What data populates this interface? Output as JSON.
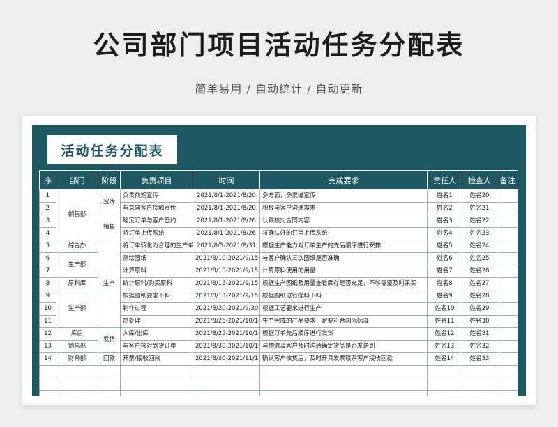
{
  "page": {
    "main_title": "公司部门项目活动任务分配表",
    "subtitle": "简单易用 / 自动统计 / 自动更新"
  },
  "sheet": {
    "title": "活动任务分配表",
    "headers": [
      "序",
      "部门",
      "阶段",
      "负责项目",
      "时间",
      "完成要求",
      "责任人",
      "检查人",
      "备注"
    ],
    "rows": [
      {
        "no": "1",
        "item": "负责前期宣传",
        "time": "2021/8/1-2021/8/20",
        "req": "多方面，多渠道宣传",
        "owner": "姓名1",
        "checker": "姓名20",
        "note": ""
      },
      {
        "no": "2",
        "item": "与意向客户接触宣传",
        "time": "2021/8/1-2021/8/20",
        "req": "积极与客户沟通需求",
        "owner": "姓名2",
        "checker": "姓名21",
        "note": ""
      },
      {
        "no": "3",
        "item": "确定订单与客户签约",
        "time": "2021/8/1-2021/8/26",
        "req": "认真核对合同内容",
        "owner": "姓名3",
        "checker": "姓名22",
        "note": ""
      },
      {
        "no": "4",
        "item": "将订单上传系统",
        "time": "2021/8/1-2021/8/26",
        "req": "将确认好的订单上传系统",
        "owner": "姓名4",
        "checker": "姓名23",
        "note": ""
      },
      {
        "no": "5",
        "item": "将订单转化为合理的生产单",
        "time": "2021/8/5-2021/8/31",
        "req": "根据生产能力对订单生产的先后顺序进行安排",
        "owner": "姓名5",
        "checker": "姓名24",
        "note": ""
      },
      {
        "no": "6",
        "item": "测绘图纸",
        "time": "2021/8/10-2021/9/15",
        "req": "与客户确认三次图纸是否准确",
        "owner": "姓名6",
        "checker": "姓名25",
        "note": ""
      },
      {
        "no": "7",
        "item": "计算原料",
        "time": "2021/8/10-2021/9/15",
        "req": "计算原料使用的用量",
        "owner": "姓名7",
        "checker": "姓名26",
        "note": ""
      },
      {
        "no": "8",
        "item": "统计原料/购买原料",
        "time": "2021/8/13-2021/9/15",
        "req": "根据生产图纸及用量查看库存是否充足，不够需要及时采买",
        "owner": "姓名8",
        "checker": "姓名27",
        "note": ""
      },
      {
        "no": "9",
        "item": "根据图纸要求下料",
        "time": "2021/8/13-2021/9/15",
        "req": "根据图纸进行提料下料",
        "owner": "姓名9",
        "checker": "姓名28",
        "note": ""
      },
      {
        "no": "10",
        "item": "制作过程",
        "time": "2021/8/20-2021/9/30",
        "req": "根据工艺要求进行生产",
        "owner": "姓名10",
        "checker": "姓名29",
        "note": ""
      },
      {
        "no": "11",
        "item": "热处理",
        "time": "2021/8/25-2021/10/10",
        "req": "生产完成的产品要求一定要符合国际标准",
        "owner": "姓名11",
        "checker": "姓名30",
        "note": ""
      },
      {
        "no": "12",
        "item": "入库/出库",
        "time": "2021/8/25-2021/10/10",
        "req": "根据订单先后顺序进行发货",
        "owner": "姓名12",
        "checker": "姓名31",
        "note": ""
      },
      {
        "no": "13",
        "item": "与客户核对到货订单",
        "time": "2021/8/30-2021/10/10",
        "req": "与物流及客户及时沟通确定货品是否发送到",
        "owner": "姓名13",
        "checker": "姓名32",
        "note": ""
      },
      {
        "no": "14",
        "item": "开票/接收回款",
        "time": "2021/8/30-2021/11/10",
        "req": "确认客户收货后，及时开具发票联系客户接收回款",
        "owner": "姓名14",
        "checker": "姓名33",
        "note": ""
      }
    ],
    "dept_groups": [
      {
        "label": "销售部",
        "span": 4
      },
      {
        "label": "综合办",
        "span": 1
      },
      {
        "label": "生产部",
        "span": 2
      },
      {
        "label": "原料库",
        "span": 1
      },
      {
        "label": "生产部",
        "span": 3
      },
      {
        "label": "库房",
        "span": 1
      },
      {
        "label": "销售部",
        "span": 1
      },
      {
        "label": "财务部",
        "span": 1
      }
    ],
    "stage_groups": [
      {
        "label": "宣传",
        "span": 2
      },
      {
        "label": "销售",
        "span": 2
      },
      {
        "label": "生产",
        "span": 7
      },
      {
        "label": "发货",
        "span": 2
      },
      {
        "label": "回款",
        "span": 1
      }
    ],
    "blank_rows": 3
  }
}
